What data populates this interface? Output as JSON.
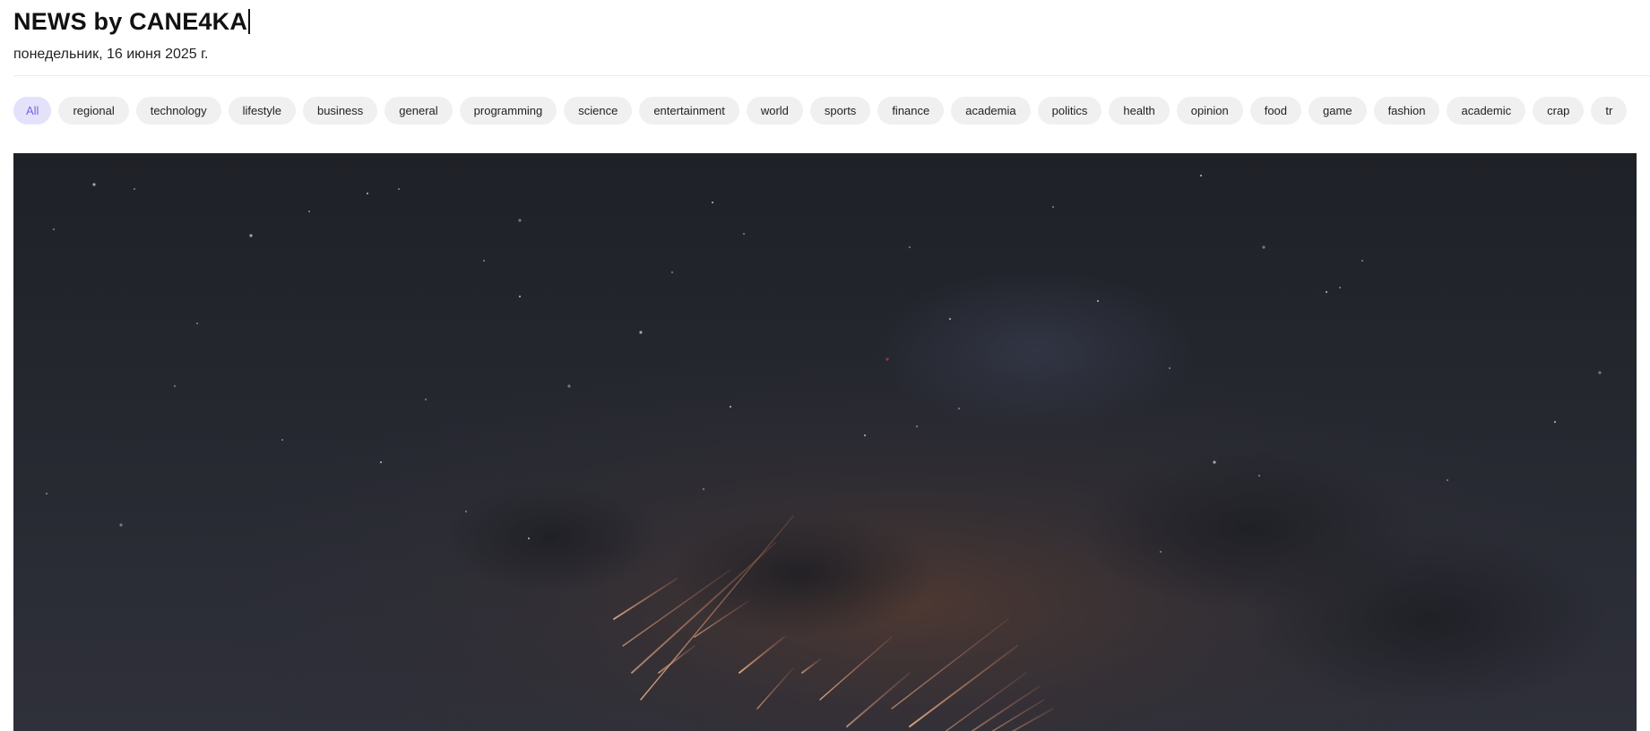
{
  "site": {
    "title": "NEWS by CANE4KA",
    "date": "понедельник, 16 июня 2025 г."
  },
  "categories": {
    "active": "All",
    "items": [
      "All",
      "regional",
      "technology",
      "lifestyle",
      "business",
      "general",
      "programming",
      "science",
      "entertainment",
      "world",
      "sports",
      "finance",
      "academia",
      "politics",
      "health",
      "opinion",
      "food",
      "game",
      "fashion",
      "academic",
      "crap",
      "tr"
    ]
  },
  "colors": {
    "accent": "#6f66e0",
    "accent_bg": "#e4e2fb",
    "chip_bg": "#f0f0f1",
    "hero_bg": "#25272f"
  },
  "hero": {
    "description_icon": "night-sky-photo"
  }
}
